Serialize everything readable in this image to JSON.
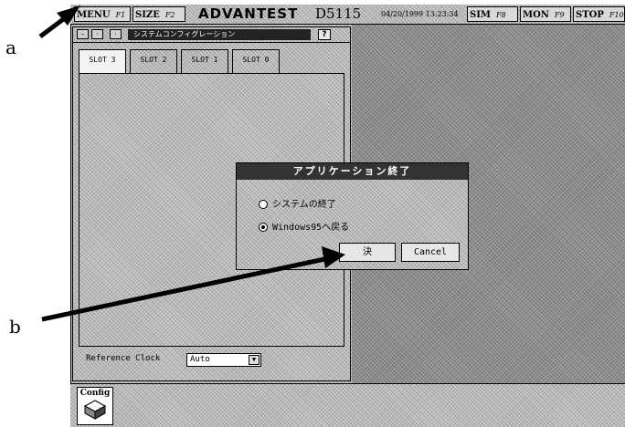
{
  "topbar": {
    "menu": {
      "label": "MENU",
      "fkey": "F1"
    },
    "size": {
      "label": "SIZE",
      "fkey": "F2"
    },
    "logo": "ADVANTEST",
    "model": "D5115",
    "datetime": "04/20/1999 13:23:34",
    "sim": {
      "label": "SIM",
      "fkey": "F8"
    },
    "mon": {
      "label": "MON",
      "fkey": "F9"
    },
    "stop": {
      "label": "STOP",
      "fkey": "F10"
    }
  },
  "config_window": {
    "title": "システムコンフィグレーション",
    "help": "?",
    "tabs": [
      "SLOT 3",
      "SLOT 2",
      "SLOT 1",
      "SLOT 0"
    ],
    "active_tab": 0,
    "reference_clock_label": "Reference Clock",
    "reference_clock_value": "Auto"
  },
  "dialog": {
    "title": "アプリケーション終了",
    "options": [
      {
        "label": "システムの終了",
        "selected": false
      },
      {
        "label": "Windows95へ戻る",
        "selected": true
      }
    ],
    "ok_label": "決",
    "cancel_label": "Cancel"
  },
  "launcher": {
    "config_label": "Config"
  },
  "annotations": {
    "a": "a",
    "b": "b"
  }
}
